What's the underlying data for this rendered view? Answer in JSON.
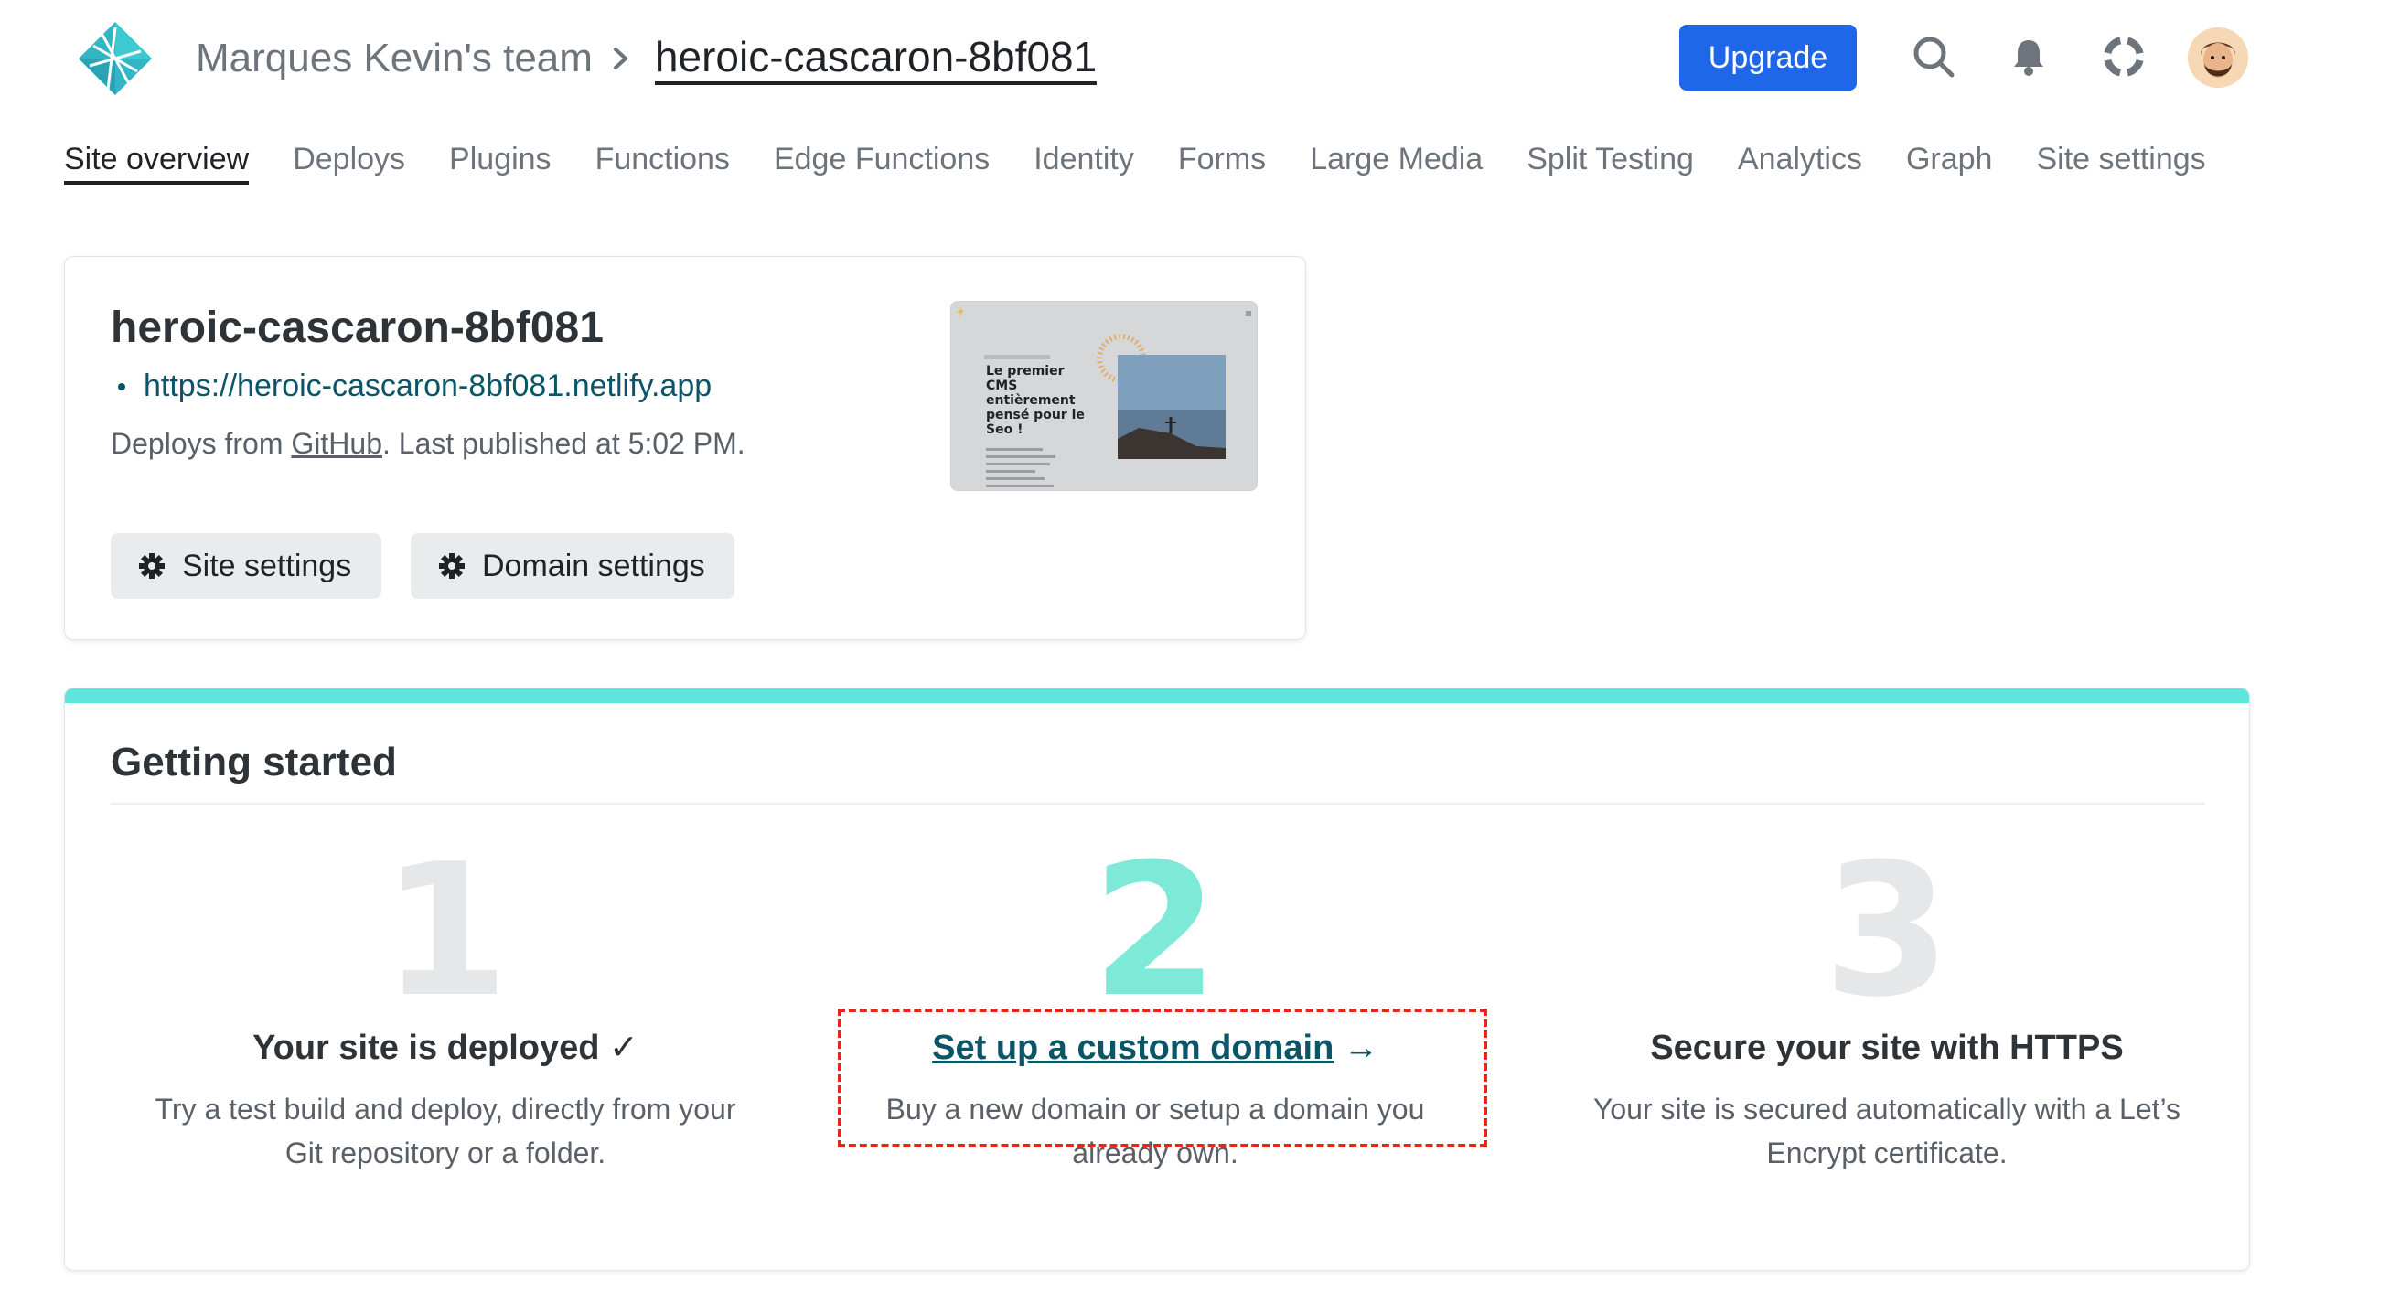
{
  "header": {
    "team_name": "Marques Kevin's team",
    "site_name": "heroic-cascaron-8bf081",
    "upgrade_label": "Upgrade",
    "icons": [
      "netlify-logo-icon",
      "chevron-right-icon",
      "search-icon",
      "bell-icon",
      "help-lifebuoy-icon",
      "avatar"
    ]
  },
  "tabs": [
    {
      "label": "Site overview",
      "active": true
    },
    {
      "label": "Deploys"
    },
    {
      "label": "Plugins"
    },
    {
      "label": "Functions"
    },
    {
      "label": "Edge Functions"
    },
    {
      "label": "Identity"
    },
    {
      "label": "Forms"
    },
    {
      "label": "Large Media"
    },
    {
      "label": "Split Testing"
    },
    {
      "label": "Analytics"
    },
    {
      "label": "Graph"
    },
    {
      "label": "Site settings"
    }
  ],
  "site_card": {
    "title": "heroic-cascaron-8bf081",
    "url": "https://heroic-cascaron-8bf081.netlify.app",
    "deploy_prefix": "Deploys from ",
    "deploy_source": "GitHub",
    "deploy_suffix": ". Last published at 5:02 PM.",
    "site_settings_label": "Site settings",
    "domain_settings_label": "Domain settings",
    "preview": {
      "heading": "Le premier CMS entièrement pensé pour le Seo !"
    }
  },
  "getting_started": {
    "title": "Getting started",
    "steps": [
      {
        "number": "1",
        "title": "Your site is deployed ✓",
        "desc_line1": "Try a test build and deploy, directly from your",
        "desc_line2": "Git repository or a folder."
      },
      {
        "number": "2",
        "title": "Set up a custom domain",
        "arrow": "→",
        "desc_line1": "Buy a new domain or setup a domain you",
        "desc_line2": "already own."
      },
      {
        "number": "3",
        "title": "Secure your site with HTTPS",
        "desc_line1": "Your site is secured automatically with a Let’s",
        "desc_line2": "Encrypt certificate."
      }
    ]
  },
  "colors": {
    "accent_teal": "#5ee6dc",
    "upgrade_blue": "#1e67e9",
    "link": "#0a5568",
    "highlight_red": "#e5261d"
  }
}
